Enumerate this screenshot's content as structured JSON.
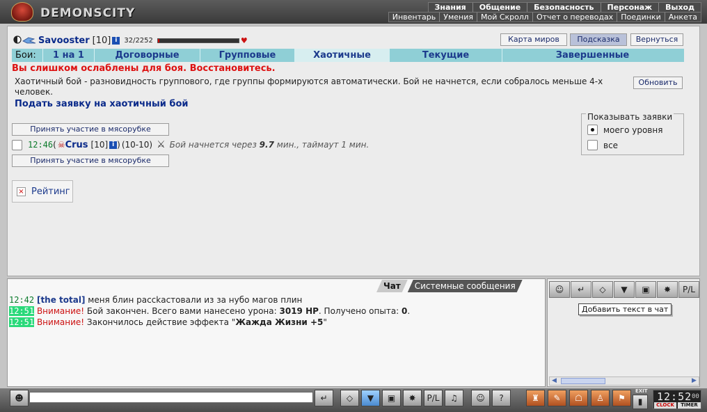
{
  "header": {
    "logo_text": "DEMONSCITY",
    "nav_top": [
      "Знания",
      "Общение",
      "Безопасность",
      "Персонаж",
      "Выход"
    ],
    "nav_bottom": [
      "Инвентарь",
      "Умения",
      "Мой Скролл",
      "Отчет о переводах",
      "Поединки",
      "Анкета"
    ]
  },
  "player": {
    "name": "Savooster",
    "level": "[10]",
    "info": "i",
    "hp_text": "32/2252",
    "hp_fraction": 0.0142
  },
  "buttons": {
    "map": "Карта миров",
    "hint": "Подсказка",
    "back": "Вернуться",
    "refresh": "Обновить"
  },
  "tabs": {
    "label": "Бои:",
    "items": [
      {
        "label": "1 на 1",
        "active": false
      },
      {
        "label": "Договорные",
        "active": false
      },
      {
        "label": "Групповые",
        "active": false
      },
      {
        "label": "Хаотичные",
        "active": true
      },
      {
        "label": "Текущие",
        "active": false
      },
      {
        "label": "Завершенные",
        "active": false
      }
    ]
  },
  "error_msg": "Вы слишком ослаблены для боя. Восстановитесь.",
  "description": "Хаотичный бой - разновидность группового, где группы формируются автоматически. Бой не начнется, если собралось меньше 4-х человек.",
  "apply_link": "Подать заявку на хаотичный бой",
  "filter": {
    "legend": "Показывать заявки",
    "options": [
      {
        "label": "моего уровня",
        "checked": true
      },
      {
        "label": "все",
        "checked": false
      }
    ]
  },
  "join_label": "Принять участие в мясорубке",
  "bid": {
    "time": "12:46",
    "open": " (",
    "player": "Crus",
    "level": "[10]",
    "info": "i",
    "close": ")",
    "levels": "(10-10)",
    "status_prefix": "Бой начнется через",
    "status_minutes": "9.7",
    "status_suffix": "мин., таймаут 1 мин."
  },
  "rating": {
    "icon": "×",
    "label": "Рейтинг"
  },
  "chat": {
    "tabs": [
      "Чат",
      "Системные сообщения"
    ],
    "messages": [
      {
        "time": "12:42",
        "type": "normal",
        "nick": "[the total]",
        "text": " меня блин рассkастовали из за нубо магов плин"
      },
      {
        "time": "12:51",
        "type": "sys",
        "warn": "Внимание!",
        "text": " Бой закончен. Всего вами нанесено урона: ",
        "b1": "3019 HP",
        "text2": ". Получено опыта: ",
        "b2": "0",
        "text3": "."
      },
      {
        "time": "12:51",
        "type": "sys",
        "warn": "Внимание!",
        "text": " Закончилось действие эффекта \"",
        "b1": "Жажда Жизни +5",
        "text2": "\"",
        "b2": "",
        "text3": ""
      }
    ]
  },
  "right_panel": {
    "tooltip": "Добавить текст в чат",
    "tools": [
      "☺",
      "↵",
      "◇",
      "▼",
      "▣",
      "✸",
      "P/L"
    ]
  },
  "bottom": {
    "input_value": "",
    "exit_label": "EXIT",
    "clock_time": "12:52",
    "clock_sec": "00",
    "clock_btn": "CLOCK",
    "timer_btn": "TIMER"
  },
  "colors": {
    "tab_bg": "#8fcfd6",
    "error": "#dd1111",
    "link": "#0a2a8a",
    "sys_time_bg": "#2ad97a"
  }
}
